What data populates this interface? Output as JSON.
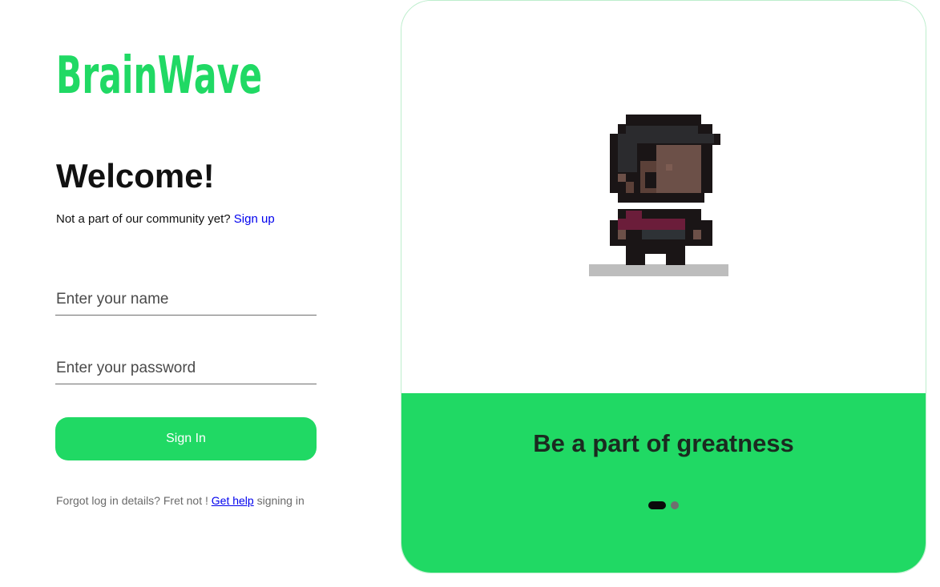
{
  "brand": {
    "name": "BrainWave",
    "color": "#20d964"
  },
  "login": {
    "heading": "Welcome!",
    "signup_prompt": "Not a part of our community yet?",
    "signup_link": "Sign up",
    "name_placeholder": "Enter your name",
    "password_placeholder": "Enter your password",
    "signin_label": "Sign In",
    "forgot_prefix": "Forgot log in details? Fret not !",
    "help_link": "Get help",
    "forgot_suffix": "signing in"
  },
  "carousel": {
    "tagline": "Be a part of greatness",
    "slide_count": 2,
    "active_slide": 1,
    "image_icon": "pixel-character-icon",
    "accent_color": "#20d964"
  }
}
